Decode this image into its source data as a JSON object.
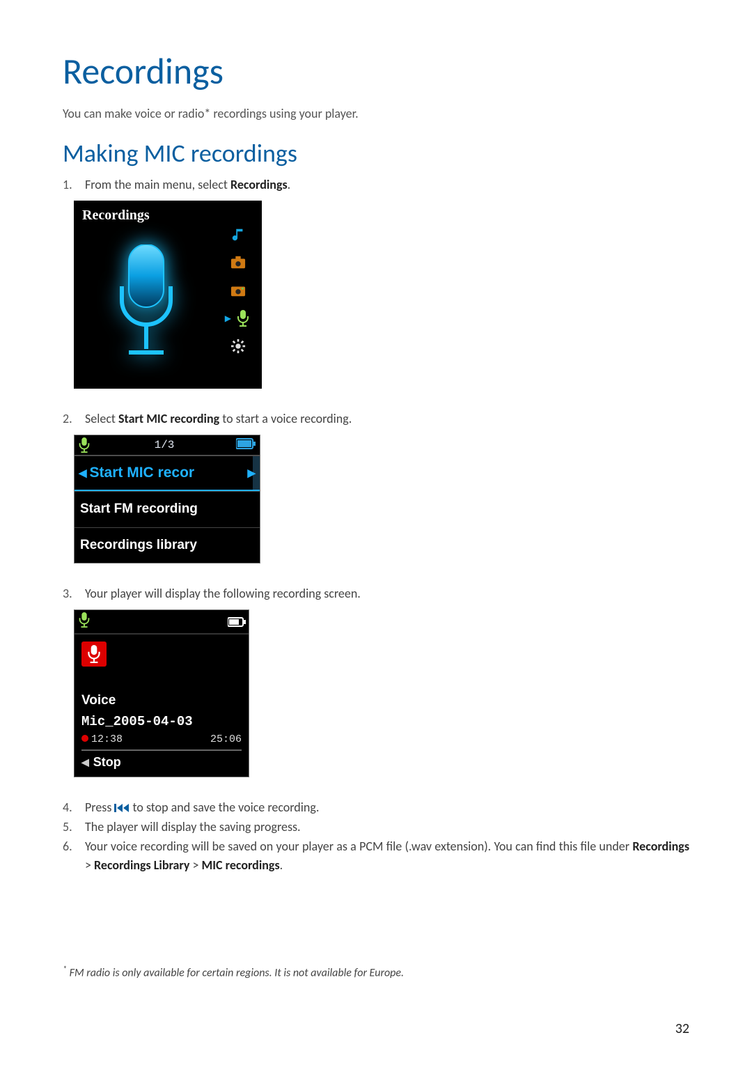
{
  "title": "Recordings",
  "intro": "You can make voice or radio* recordings using your player.",
  "subtitle": "Making MIC recordings",
  "steps": {
    "s1_pre": "From the main menu, select ",
    "s1_b": "Recordings",
    "s1_post": ".",
    "s2_pre": "Select ",
    "s2_b": "Start MIC recording",
    "s2_post": " to start a voice recording.",
    "s3": "Your player will display the following recording screen.",
    "s4_pre": "Press ",
    "s4_post": " to stop and save the voice recording.",
    "s5": "The player will display the saving progress.",
    "s6_pre": "Your voice recording will be saved on your player as a PCM file (.wav extension). You can find this file under ",
    "s6_b1": "Recordings",
    "s6_sep1": " > ",
    "s6_b2": "Recordings Library",
    "s6_sep2": " > ",
    "s6_b3": "MIC recordings",
    "s6_post": "."
  },
  "dev1": {
    "header": "Recordings",
    "icons": [
      "music-icon",
      "folder-icon",
      "picture-icon",
      "mic-icon",
      "settings-icon"
    ]
  },
  "dev2": {
    "count": "1/3",
    "selected": "Start MIC recor",
    "row2": "Start FM recording",
    "row3": "Recordings library"
  },
  "dev3": {
    "voice_label": "Voice",
    "filename": "Mic_2005-04-03",
    "elapsed": "12:38",
    "remain": "25:06",
    "stop": "Stop"
  },
  "footnote_ast": "*",
  "footnote": " FM radio is only available for certain regions. It is not available for Europe.",
  "page_number": "32"
}
